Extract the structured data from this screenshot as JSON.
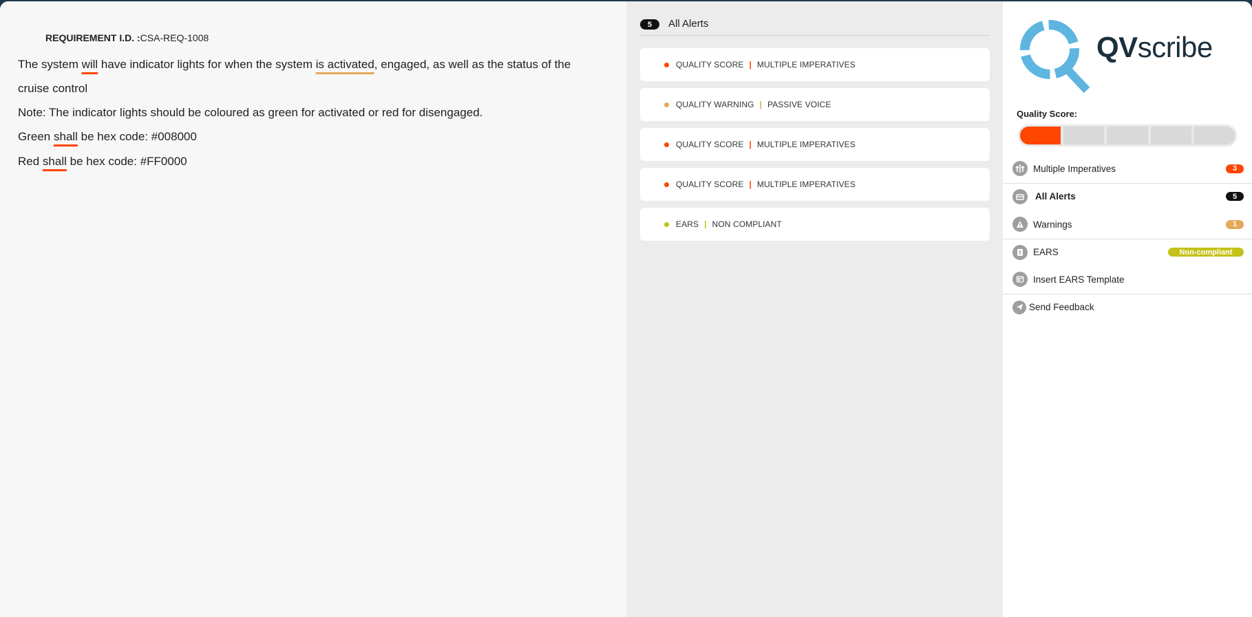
{
  "colors": {
    "critical": "#ff4500",
    "warning": "#e3a95a",
    "ears": "#c3c218",
    "dark": "#111111",
    "brand_blue": "#5db5e0"
  },
  "document": {
    "req_id_label": "REQUIREMENT I.D. :",
    "req_id_value": "CSA-REQ-1008",
    "p1": {
      "t1": "The system ",
      "u1": "will",
      "t2": " have indicator lights for when the system ",
      "u2": "is activated",
      "t3": ", engaged, as well as the status of the cruise control"
    },
    "p2": "Note: The indicator lights should be coloured as green for activated or red for disengaged.",
    "p3": {
      "t1": "Green ",
      "u1": "shall",
      "t2": " be hex code: #008000"
    },
    "p4": {
      "t1": "Red ",
      "u1": "shall",
      "t2": " be hex code:  #FF0000"
    }
  },
  "alerts_panel": {
    "count": "5",
    "title": "All Alerts",
    "items": [
      {
        "category": "QUALITY SCORE",
        "issue": "MULTIPLE IMPERATIVES",
        "color": "#ff4500"
      },
      {
        "category": "QUALITY WARNING",
        "issue": "PASSIVE VOICE",
        "color": "#e3a95a"
      },
      {
        "category": "QUALITY SCORE",
        "issue": "MULTIPLE IMPERATIVES",
        "color": "#ff4500"
      },
      {
        "category": "QUALITY SCORE",
        "issue": "MULTIPLE IMPERATIVES",
        "color": "#ff4500"
      },
      {
        "category": "EARS",
        "issue": "NON  COMPLIANT",
        "color": "#c3c218"
      }
    ]
  },
  "sidebar": {
    "logo": {
      "bold": "QV",
      "rest": "scribe"
    },
    "quality_score_label": "Quality Score:",
    "quality_score": {
      "filled_segments": 1,
      "total_segments": 5
    },
    "items": [
      {
        "label": "Multiple Imperatives",
        "badge": "3",
        "icon": "multiple-imperatives-icon"
      },
      {
        "label": "All Alerts",
        "badge": "5",
        "icon": "inbox-icon"
      },
      {
        "label": "Warnings",
        "badge": "1",
        "icon": "warning-icon"
      },
      {
        "label": "EARS",
        "badge": "Non-compliant",
        "icon": "document-icon"
      },
      {
        "label": "Insert EARS Template",
        "badge": "",
        "icon": "template-icon"
      },
      {
        "label": "Send Feedback",
        "badge": "",
        "icon": "send-icon"
      }
    ]
  }
}
